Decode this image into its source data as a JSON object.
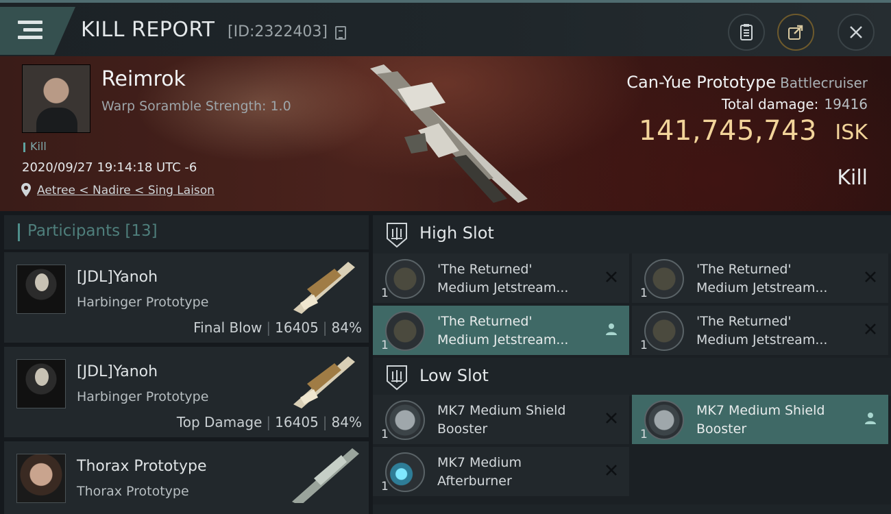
{
  "header": {
    "title": "KILL REPORT",
    "report_id": "[ID:2322403]",
    "buttons": [
      "clipboard-icon",
      "share-icon",
      "close-icon"
    ]
  },
  "victim": {
    "name": "Reimrok",
    "warp_scramble": "Warp Soramble Strength: 1.0",
    "tag": "Kill",
    "datetime": "2020/09/27 19:14:18 UTC -6",
    "location": "Aetree < Nadire < Sing Laison",
    "ship_name": "Can-Yue Prototype",
    "ship_class": "Battlecruiser",
    "total_damage_label": "Total damage:",
    "total_damage": "19416",
    "isk_value": "141,745,743",
    "isk_unit": "ISK",
    "result": "Kill"
  },
  "participants": {
    "label": "Participants [13]",
    "list": [
      {
        "name": "[JDL]Yanoh",
        "ship": "Harbinger Prototype",
        "role": "Final Blow",
        "damage": "16405",
        "percent": "84%"
      },
      {
        "name": "[JDL]Yanoh",
        "ship": "Harbinger Prototype",
        "role": "Top Damage",
        "damage": "16405",
        "percent": "84%"
      },
      {
        "name": "Thorax Prototype",
        "ship": "Thorax Prototype",
        "role": "",
        "damage": "",
        "percent": ""
      }
    ]
  },
  "fitting": {
    "high_slot_label": "High Slot",
    "low_slot_label": "Low Slot",
    "high_slots": [
      {
        "line1": "'The Returned'",
        "line2": "Medium Jetstream...",
        "qty": "1",
        "state": "destroyed"
      },
      {
        "line1": "'The Returned'",
        "line2": "Medium Jetstream...",
        "qty": "1",
        "state": "destroyed"
      },
      {
        "line1": "'The Returned'",
        "line2": "Medium Jetstream...",
        "qty": "1",
        "state": "dropped"
      },
      {
        "line1": "'The Returned'",
        "line2": "Medium Jetstream...",
        "qty": "1",
        "state": "destroyed"
      }
    ],
    "low_slots": [
      {
        "line1": "MK7 Medium Shield",
        "line2": "Booster",
        "qty": "1",
        "state": "destroyed"
      },
      {
        "line1": "MK7 Medium Shield",
        "line2": "Booster",
        "qty": "1",
        "state": "dropped"
      },
      {
        "line1": "MK7 Medium",
        "line2": "Afterburner",
        "qty": "1",
        "state": "destroyed"
      }
    ]
  },
  "colors": {
    "accent": "#3f6966",
    "isk": "#f2d49a",
    "menu": "#35504f"
  }
}
